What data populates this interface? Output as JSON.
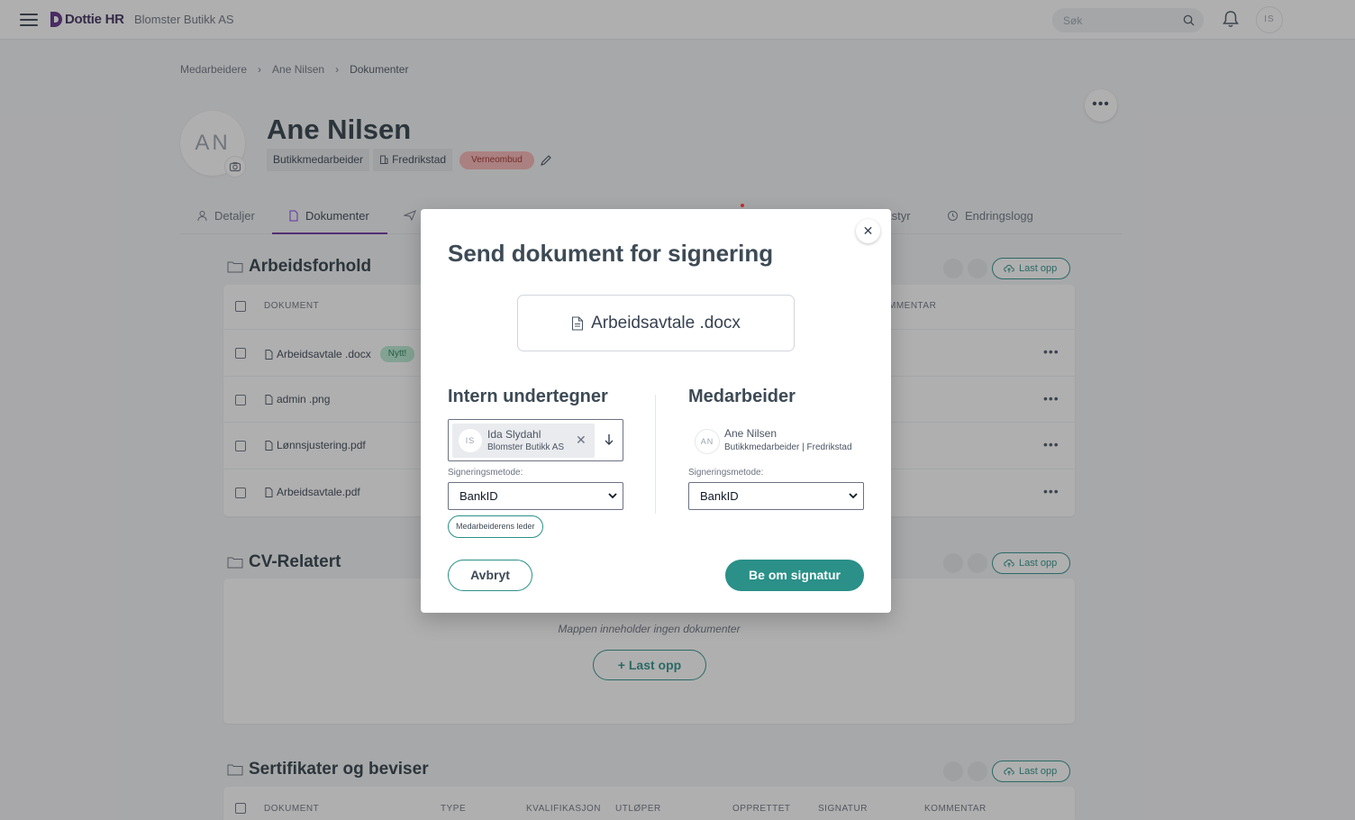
{
  "topbar": {
    "brand": "Dottie HR",
    "company": "Blomster Butikk AS",
    "search_placeholder": "Søk",
    "user_initials": "IS"
  },
  "breadcrumb": [
    "Medarbeidere",
    "Ane Nilsen",
    "Dokumenter"
  ],
  "profile": {
    "initials": "AN",
    "name": "Ane Nilsen",
    "role": "Butikkmedarbeider",
    "location": "Fredrikstad",
    "badge": "Verneombud"
  },
  "tabs": [
    {
      "label": "Detaljer",
      "icon": "user-icon"
    },
    {
      "label": "Dokumenter",
      "icon": "document-icon",
      "active": true
    },
    {
      "label": "",
      "icon": "plane-icon"
    },
    {
      "label": "tstyr",
      "icon": ""
    },
    {
      "label": "Endringslogg",
      "icon": "clock-icon"
    }
  ],
  "sections": [
    {
      "title": "Arbeidsforhold",
      "upload_label": "Last opp",
      "headers": [
        "DOKUMENT",
        "MMENTAR"
      ],
      "rows": [
        {
          "name": "Arbeidsavtale .docx",
          "badge": "Nytt!"
        },
        {
          "name": "admin .png"
        },
        {
          "name": "Lønnsjustering.pdf"
        },
        {
          "name": "Arbeidsavtale.pdf"
        }
      ]
    },
    {
      "title": "CV-Relatert",
      "upload_label": "Last opp",
      "empty_text": "Mappen inneholder ingen dokumenter",
      "empty_upload_label": "+ Last opp"
    },
    {
      "title": "Sertifikater og beviser",
      "upload_label": "Last opp",
      "headers": [
        "DOKUMENT",
        "TYPE",
        "KVALIFIKASJON",
        "UTLØPER",
        "OPPRETTET",
        "SIGNATUR",
        "KOMMENTAR"
      ]
    }
  ],
  "modal": {
    "title": "Send dokument for signering",
    "file_name": "Arbeidsavtale .docx",
    "internal": {
      "title": "Intern undertegner",
      "signer_initials": "IS",
      "signer_name": "Ida Slydahl",
      "signer_company": "Blomster Butikk AS",
      "method_label": "Signeringsmetode:",
      "method_value": "BankID",
      "leader_pill": "Medarbeiderens leder"
    },
    "employee": {
      "title": "Medarbeider",
      "initials": "AN",
      "name": "Ane Nilsen",
      "details": "Butikkmedarbeider | Fredrikstad",
      "method_label": "Signeringsmetode:",
      "method_value": "BankID"
    },
    "cancel_label": "Avbryt",
    "submit_label": "Be om signatur"
  },
  "colors": {
    "accent": "#2a9088",
    "brand": "#5b2a86",
    "badge_red": "#f8b4b4",
    "badge_green": "#b6ead2"
  }
}
